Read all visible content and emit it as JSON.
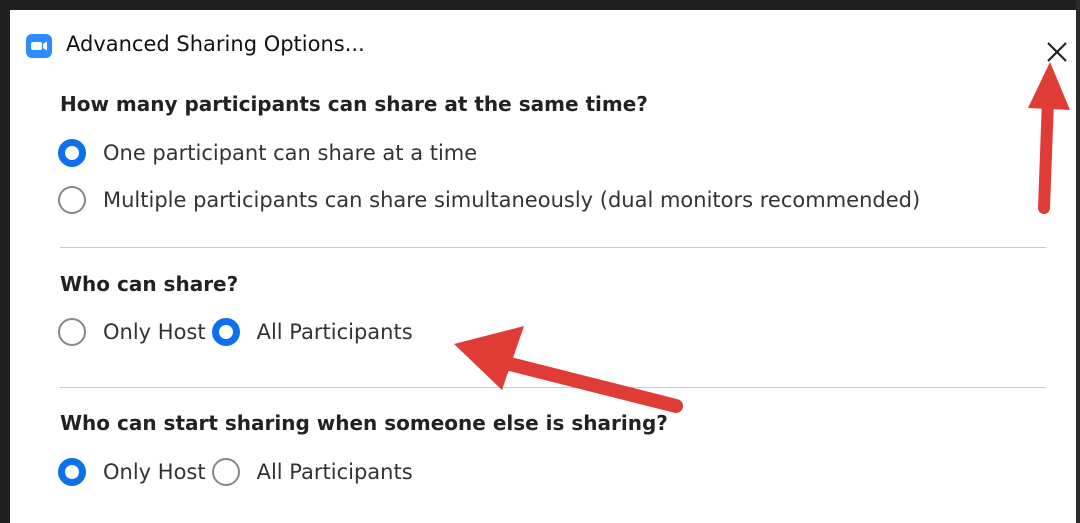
{
  "window": {
    "title": "Advanced Sharing Options...",
    "icon": "zoom-app-icon",
    "close_icon": "close-icon",
    "accent_color": "#0e71eb",
    "annotation_arrow_color": "#e03c36"
  },
  "sections": [
    {
      "heading": "How many participants can share at the same time?",
      "options": [
        {
          "label": "One participant can share at a time",
          "selected": true
        },
        {
          "label": "Multiple participants can share simultaneously (dual monitors recommended)",
          "selected": false
        }
      ]
    },
    {
      "heading": "Who can share?",
      "options": [
        {
          "label": "Only Host",
          "selected": false
        },
        {
          "label": "All Participants",
          "selected": true
        }
      ]
    },
    {
      "heading": "Who can start sharing when someone else is sharing?",
      "options": [
        {
          "label": "Only Host",
          "selected": true
        },
        {
          "label": "All Participants",
          "selected": false
        }
      ]
    }
  ]
}
